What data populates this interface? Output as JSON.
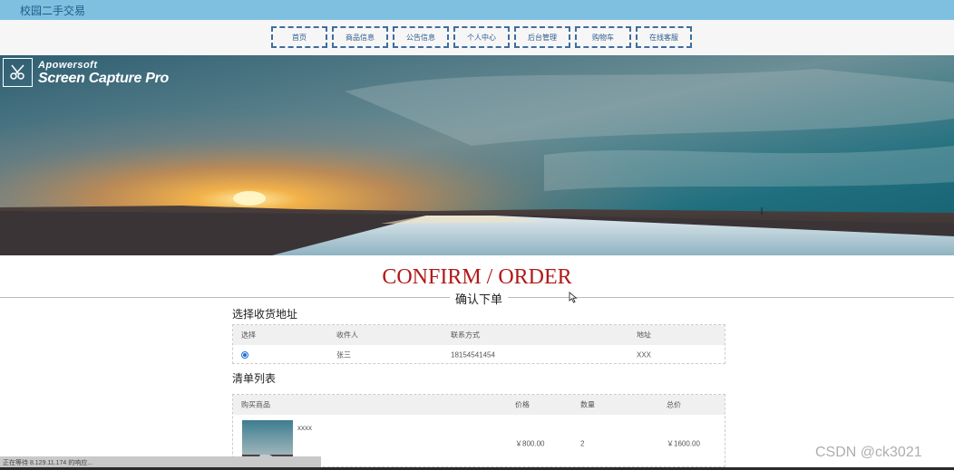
{
  "brand": "校园二手交易",
  "nav": [
    "首页",
    "商品信息",
    "公告信息",
    "个人中心",
    "后台管理",
    "购物车",
    "在线客服"
  ],
  "watermark": {
    "line1": "Apowersoft",
    "line2": "Screen Capture Pro"
  },
  "heading": "CONFIRM / ORDER",
  "subheading": "确认下单",
  "address_section": {
    "title": "选择收货地址",
    "headers": [
      "选择",
      "收件人",
      "联系方式",
      "地址"
    ],
    "rows": [
      {
        "selected": true,
        "recipient": "张三",
        "phone": "18154541454",
        "address": "XXX"
      }
    ]
  },
  "order_section": {
    "title": "清单列表",
    "headers": [
      "购买商品",
      "价格",
      "数量",
      "总价"
    ],
    "items": [
      {
        "name": "xxxx",
        "price": "￥800.00",
        "qty": "2",
        "total": "￥1600.00"
      }
    ]
  },
  "status_text": "正在等待 8.129.11.174 的响应...",
  "csdn_watermark": "CSDN @ck3021",
  "colors": {
    "topbar": "#7fc0e0",
    "nav_border": "#3f6d9e",
    "heading": "#b01818",
    "radio": "#1a6fd6"
  }
}
